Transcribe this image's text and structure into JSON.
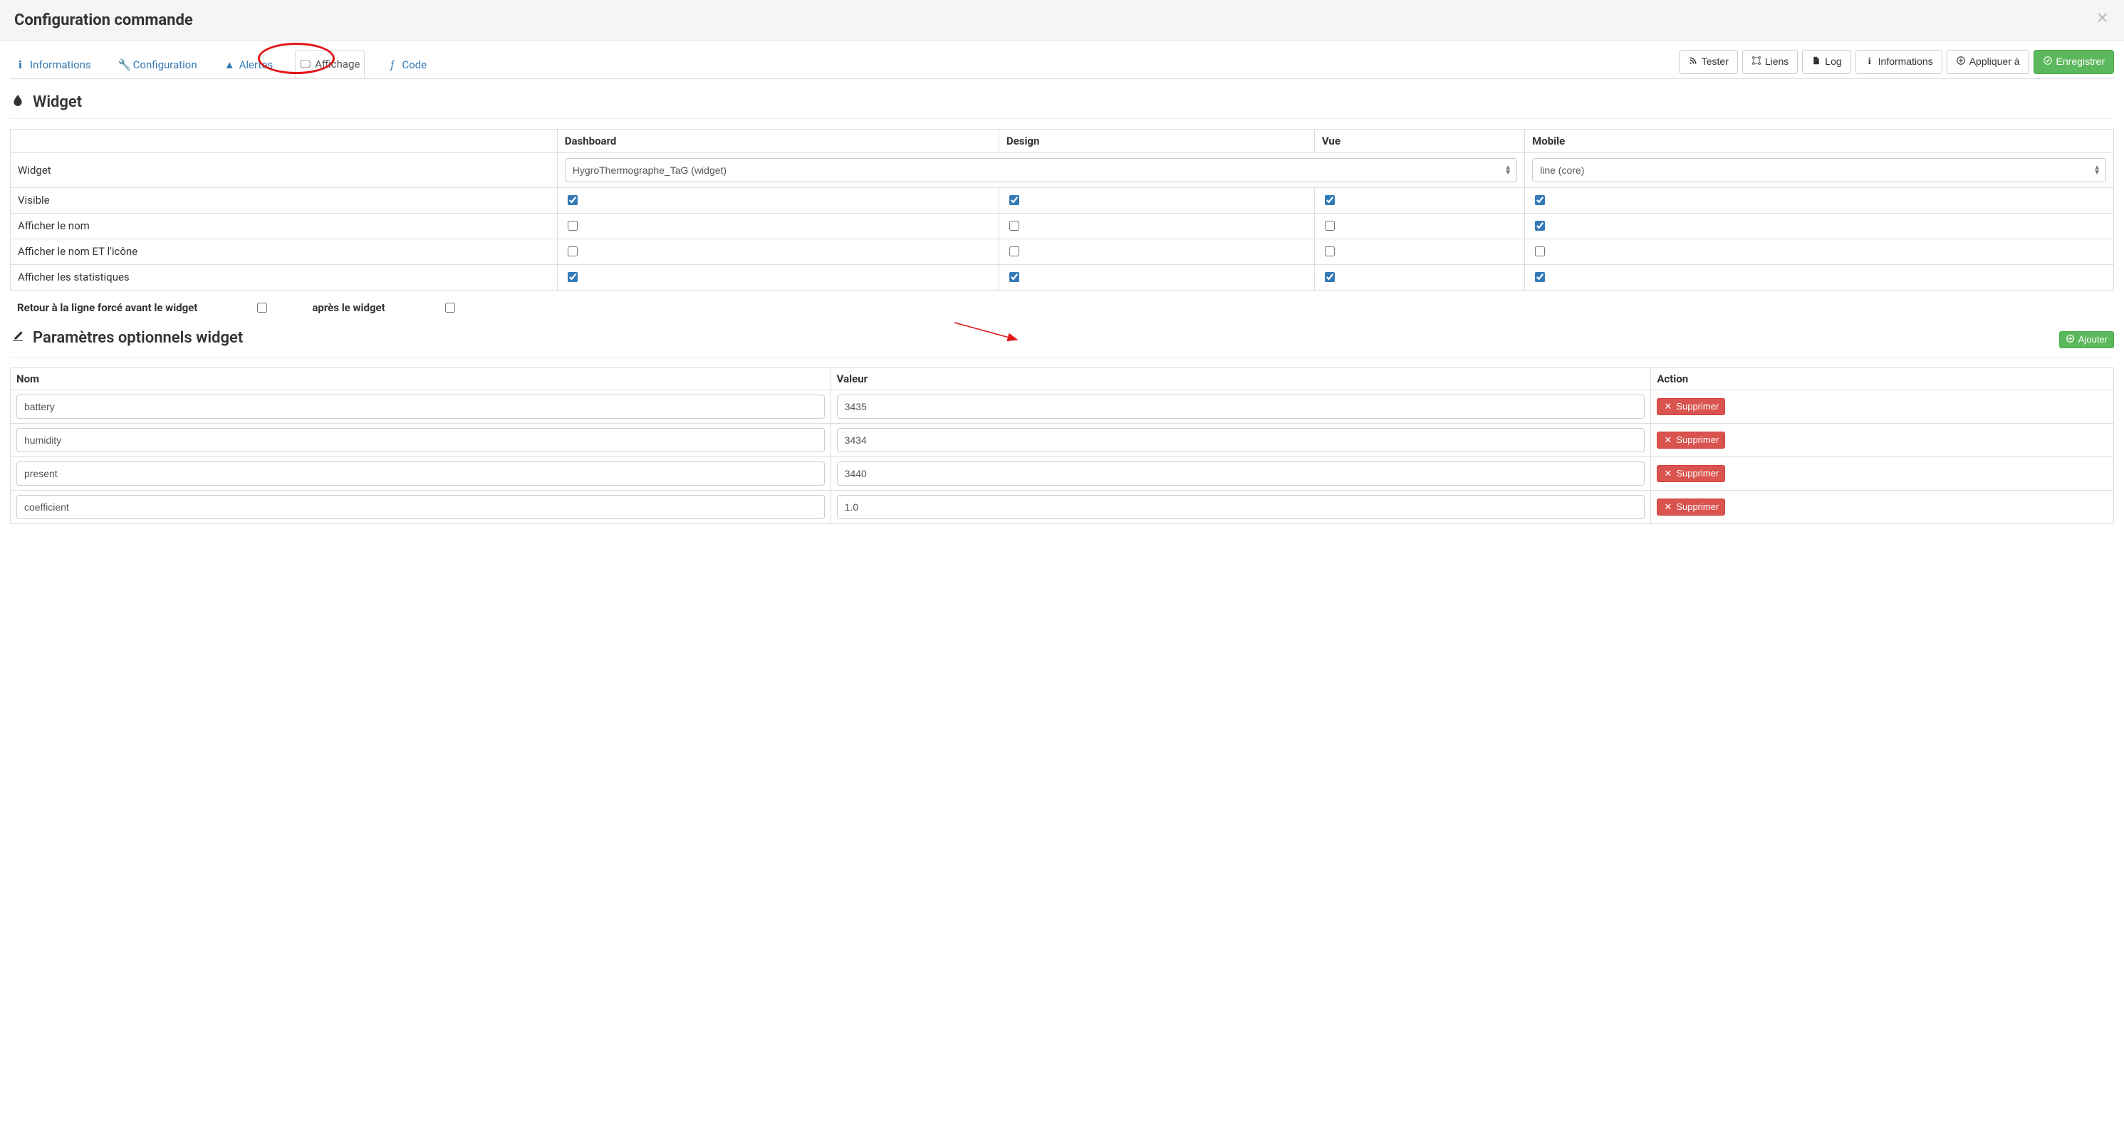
{
  "modal": {
    "title": "Configuration commande"
  },
  "tabs": {
    "informations": "Informations",
    "configuration": "Configuration",
    "alertes": "Alertes",
    "affichage": "Affichage",
    "code": "Code"
  },
  "toolbar": {
    "tester": "Tester",
    "liens": "Liens",
    "log": "Log",
    "informations": "Informations",
    "appliquer": "Appliquer à",
    "enregistrer": "Enregistrer"
  },
  "widget_section": {
    "title": "Widget"
  },
  "widget_table": {
    "headers": {
      "empty": "",
      "dashboard": "Dashboard",
      "design": "Design",
      "vue": "Vue",
      "mobile": "Mobile"
    },
    "rows": {
      "widget_label": "Widget",
      "widget_dashboard_select": "HygroThermographe_TaG (widget)",
      "widget_mobile_select": "line (core)",
      "visible": {
        "label": "Visible",
        "dashboard": true,
        "design": true,
        "vue": true,
        "mobile": true
      },
      "afficher_nom": {
        "label": "Afficher le nom",
        "dashboard": false,
        "design": false,
        "vue": false,
        "mobile": true
      },
      "afficher_nom_icone": {
        "label": "Afficher le nom ET l'icône",
        "dashboard": false,
        "design": false,
        "vue": false,
        "mobile": false
      },
      "afficher_stats": {
        "label": "Afficher les statistiques",
        "dashboard": true,
        "design": true,
        "vue": true,
        "mobile": true
      }
    }
  },
  "linebreak": {
    "before": "Retour à la ligne forcé avant le widget",
    "before_checked": false,
    "after": "après le widget",
    "after_checked": false
  },
  "params_section": {
    "title": "Paramètres optionnels widget",
    "add_button": "Ajouter"
  },
  "params_table": {
    "headers": {
      "name": "Nom",
      "value": "Valeur",
      "action": "Action"
    },
    "rows": [
      {
        "name": "battery",
        "value": "3435",
        "delete": "Supprimer"
      },
      {
        "name": "humidity",
        "value": "3434",
        "delete": "Supprimer"
      },
      {
        "name": "present",
        "value": "3440",
        "delete": "Supprimer"
      },
      {
        "name": "coefficient",
        "value": "1.0",
        "delete": "Supprimer"
      }
    ]
  }
}
